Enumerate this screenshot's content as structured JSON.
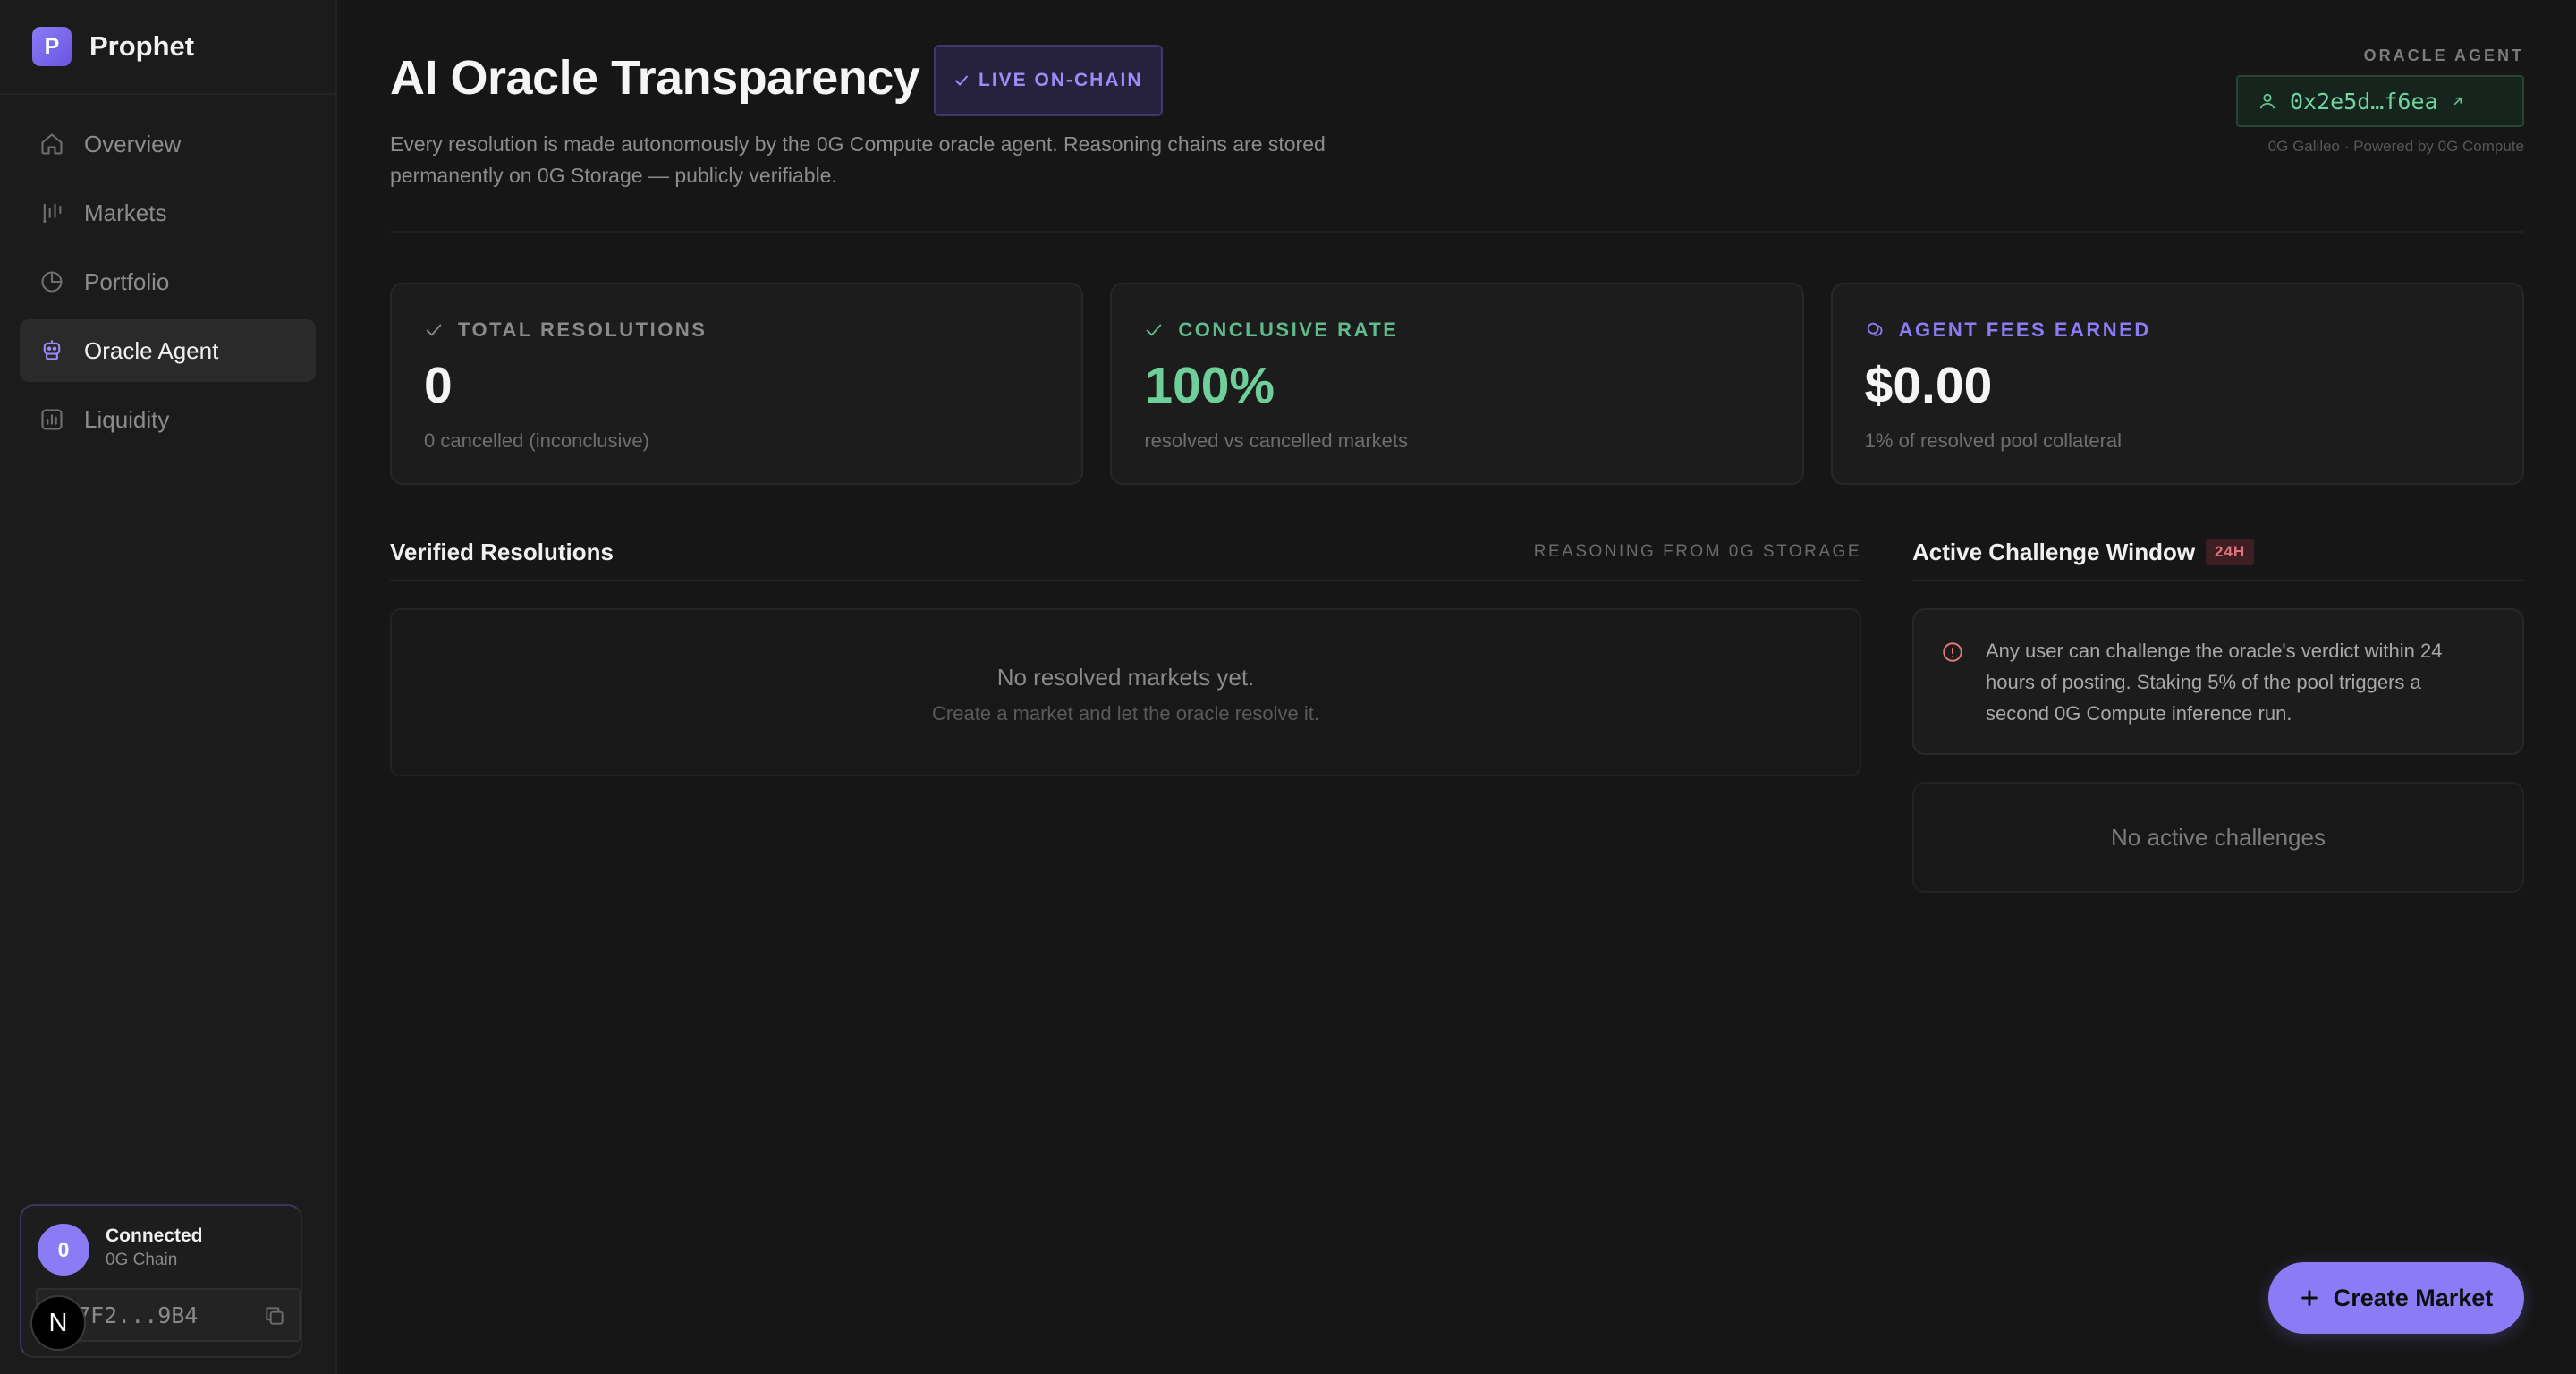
{
  "brand": {
    "logo_letter": "P",
    "name": "Prophet"
  },
  "nav": {
    "items": [
      {
        "label": "Overview",
        "icon": "home-icon"
      },
      {
        "label": "Markets",
        "icon": "markets-icon"
      },
      {
        "label": "Portfolio",
        "icon": "portfolio-icon"
      },
      {
        "label": "Oracle Agent",
        "icon": "robot-icon",
        "active": true
      },
      {
        "label": "Liquidity",
        "icon": "liquidity-icon"
      }
    ]
  },
  "wallet": {
    "avatar_letter": "0",
    "status": "Connected",
    "chain": "0G Chain",
    "address": "7F2...9B4",
    "dev_badge": "N"
  },
  "header": {
    "title": "AI Oracle Transparency",
    "live_badge": "LIVE ON-CHAIN",
    "description": "Every resolution is made autonomously by the 0G Compute oracle agent. Reasoning chains are stored permanently on 0G Storage — publicly verifiable.",
    "oracle_label": "ORACLE AGENT",
    "oracle_address": "0x2e5d…f6ea",
    "oracle_network": "0G Galileo · Powered by 0G Compute"
  },
  "stats": [
    {
      "label": "TOTAL RESOLUTIONS",
      "value": "0",
      "sub": "0 cancelled (inconclusive)",
      "icon": "check-icon",
      "color": "#8a8a8a",
      "value_color": "#f5f5f5"
    },
    {
      "label": "CONCLUSIVE RATE",
      "value": "100%",
      "sub": "resolved vs cancelled markets",
      "icon": "check-icon",
      "color": "#5fba8c",
      "value_color": "#6fcf9a"
    },
    {
      "label": "AGENT FEES EARNED",
      "value": "$0.00",
      "sub": "1% of resolved pool collateral",
      "icon": "coins-icon",
      "color": "#8b7cf6",
      "value_color": "#f5f5f5"
    }
  ],
  "resolutions": {
    "title": "Verified Resolutions",
    "meta": "REASONING FROM 0G STORAGE",
    "empty_title": "No resolved markets yet.",
    "empty_sub": "Create a market and let the oracle resolve it."
  },
  "challenge": {
    "title": "Active Challenge Window",
    "badge": "24H",
    "info": "Any user can challenge the oracle's verdict within 24 hours of posting. Staking 5% of the pool triggers a second 0G Compute inference run.",
    "empty": "No active challenges"
  },
  "actions": {
    "create_market": "Create Market"
  },
  "colors": {
    "accent": "#8b7cf6",
    "success": "#6fcf9a",
    "danger": "#e5737f",
    "background": "#161616"
  }
}
